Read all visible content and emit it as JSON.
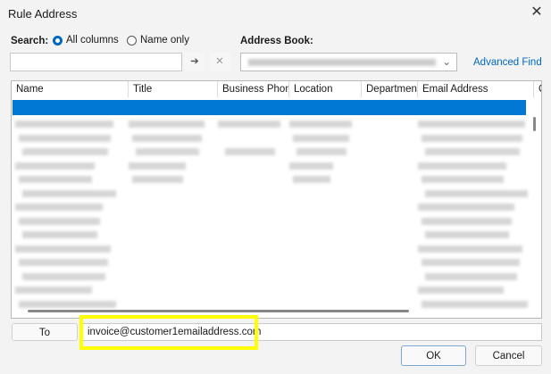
{
  "window": {
    "title": "Rule Address",
    "close_icon": "close-icon"
  },
  "search": {
    "label": "Search:",
    "options": [
      {
        "label": "All columns",
        "selected": true
      },
      {
        "label": "Name only",
        "selected": false
      }
    ],
    "value": "",
    "go_icon": "arrow-right-icon",
    "clear_icon": "x-icon"
  },
  "address_book": {
    "label": "Address Book:",
    "selected": "(redacted)"
  },
  "advanced_find": "Advanced Find",
  "columns": [
    "Name",
    "Title",
    "Business Phone",
    "Location",
    "Department",
    "Email Address",
    "C"
  ],
  "to": {
    "button": "To",
    "value": "invoice@customer1emailaddress.com"
  },
  "buttons": {
    "ok": "OK",
    "cancel": "Cancel"
  },
  "colors": {
    "accent": "#0078d4",
    "highlight": "#ffff00",
    "link": "#0067c0"
  }
}
